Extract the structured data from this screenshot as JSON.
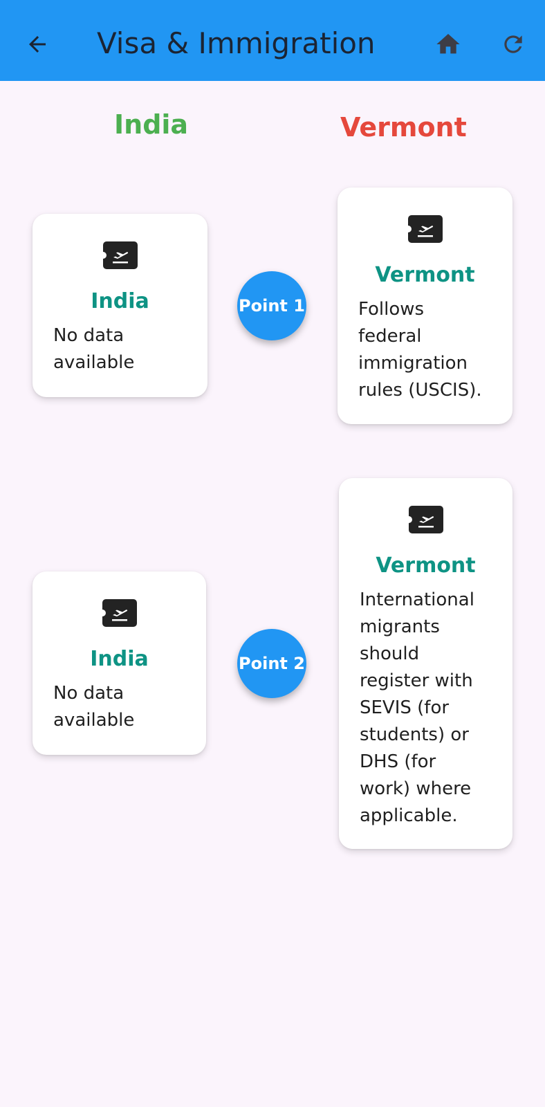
{
  "appbar": {
    "title": "Visa & Immigration",
    "back_icon": "arrow-left-icon",
    "home_icon": "home-icon",
    "refresh_icon": "refresh-icon",
    "color": "#2196f3"
  },
  "columns": {
    "left": {
      "label": "India",
      "color": "#4caf50"
    },
    "right": {
      "label": "Vermont",
      "color": "#e5483c"
    }
  },
  "rows": [
    {
      "point_label": "Point 1",
      "left_card": {
        "icon": "flight-ticket-icon",
        "title": "India",
        "text": "No data\navailable"
      },
      "right_card": {
        "icon": "flight-ticket-icon",
        "title": "Vermont",
        "text": "Follows\nfederal\nimmigration\nrules (USCIS)."
      }
    },
    {
      "point_label": "Point 2",
      "left_card": {
        "icon": "flight-ticket-icon",
        "title": "India",
        "text": "No data\navailable"
      },
      "right_card": {
        "icon": "flight-ticket-icon",
        "title": "Vermont",
        "text": "International\nmigrants\nshould\nregister with\nSEVIS (for\nstudents) or\nDHS (for\nwork) where\napplicable."
      }
    }
  ]
}
